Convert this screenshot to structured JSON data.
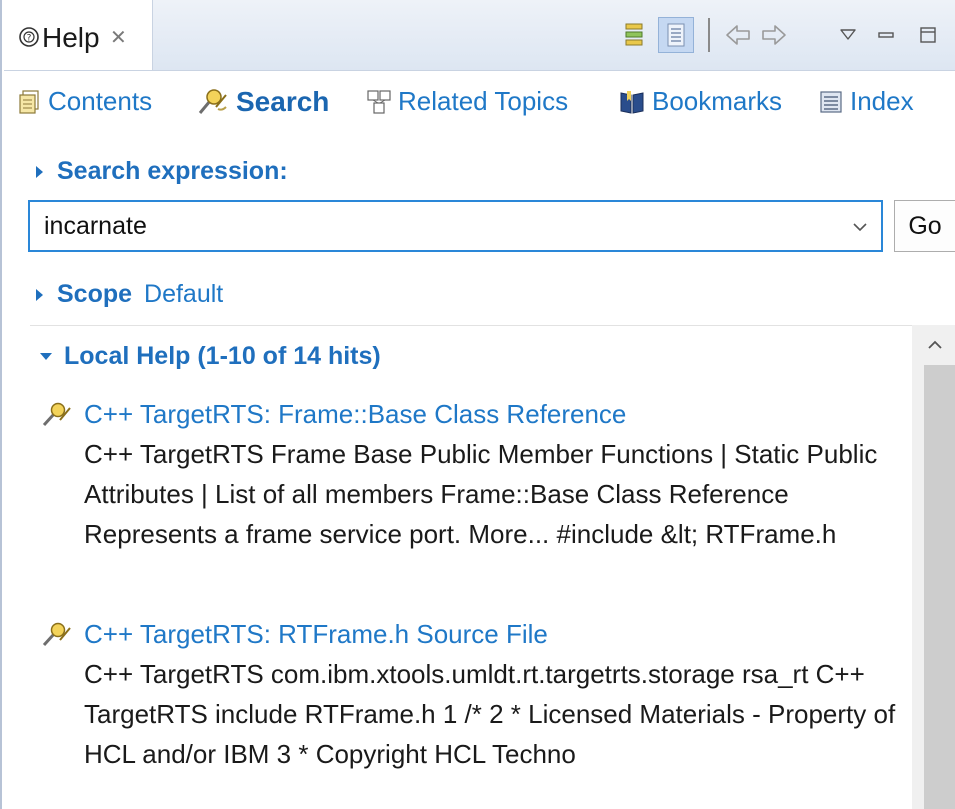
{
  "tab": {
    "label": "Help"
  },
  "nav": {
    "contents": "Contents",
    "search": "Search",
    "related": "Related Topics",
    "bookmarks": "Bookmarks",
    "index": "Index"
  },
  "search": {
    "header": "Search expression:",
    "value": "incarnate",
    "go_label": "Go"
  },
  "scope": {
    "label": "Scope",
    "value": "Default"
  },
  "results": {
    "header": "Local Help (1-10 of 14 hits)",
    "hits": [
      {
        "title": "C++ TargetRTS: Frame::Base Class Reference",
        "description": "C++ TargetRTS Frame Base Public Member Functions | Static Public Attributes | List of all members Frame::Base Class Reference Represents a frame service port. More... #include &lt; RTFrame.h"
      },
      {
        "title": "C++ TargetRTS: RTFrame.h Source File",
        "description": "C++ TargetRTS com.ibm.xtools.umldt.rt.targetrts.storage rsa_rt C++ TargetRTS include RTFrame.h 1 /* 2 * Licensed Materials - Property of HCL and/or IBM 3 * Copyright HCL Techno"
      }
    ]
  },
  "colors": {
    "link": "#1f78c7",
    "header": "#1f6fbd",
    "focus_border": "#2a87d8"
  }
}
